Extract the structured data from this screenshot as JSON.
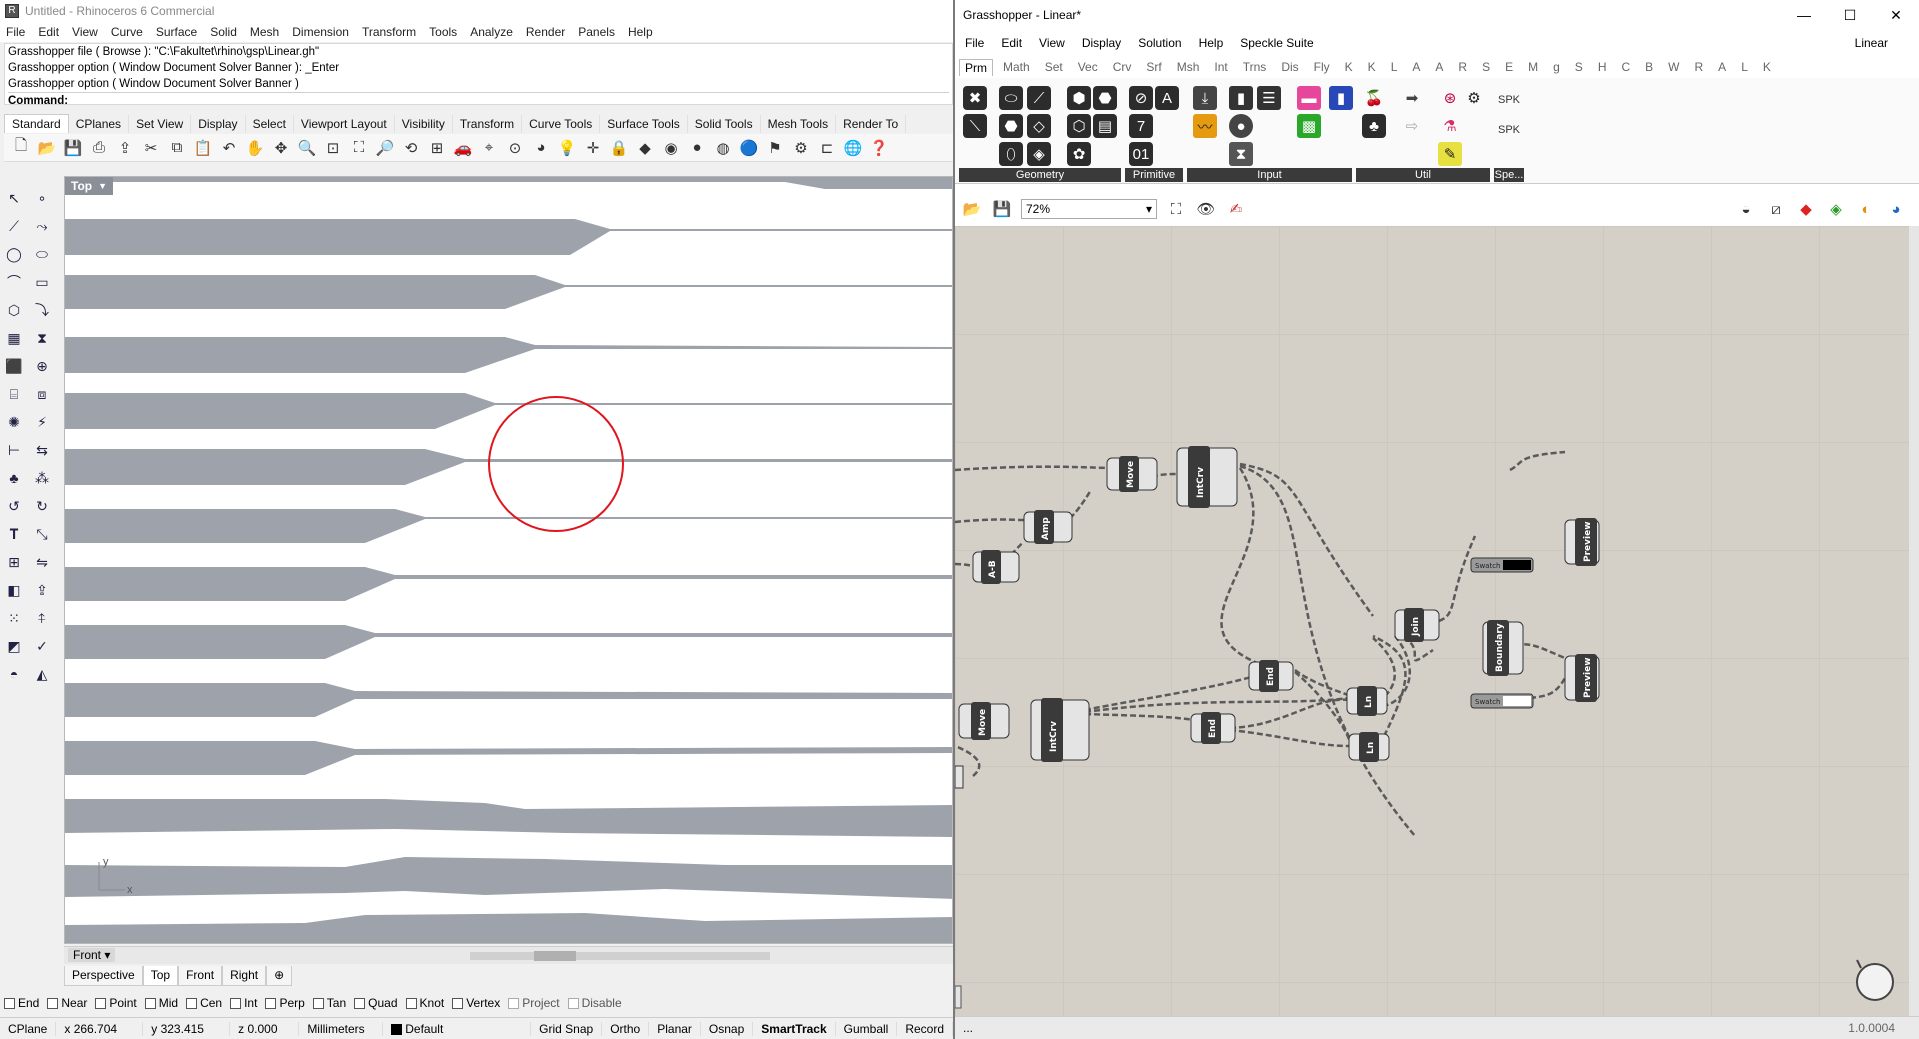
{
  "rhino": {
    "title": "Untitled - Rhinoceros 6 Commercial",
    "menu": [
      "File",
      "Edit",
      "View",
      "Curve",
      "Surface",
      "Solid",
      "Mesh",
      "Dimension",
      "Transform",
      "Tools",
      "Analyze",
      "Render",
      "Panels",
      "Help"
    ],
    "command_history": [
      "Grasshopper file ( Browse ): \"C:\\Fakultet\\rhino\\gsp\\Linear.gh\"",
      "Grasshopper option ( Window  Document  Solver  Banner ): _Enter",
      "Grasshopper option ( Window  Document  Solver  Banner )"
    ],
    "command_prompt": "Command:",
    "toolbar_tabs": [
      "Standard",
      "CPlanes",
      "Set View",
      "Display",
      "Select",
      "Viewport Layout",
      "Visibility",
      "Transform",
      "Curve Tools",
      "Surface Tools",
      "Solid Tools",
      "Mesh Tools",
      "Render To"
    ],
    "viewport_label": "Top",
    "axis_y": "y",
    "axis_x": "x",
    "bottom_view": "Front",
    "view_tabs": [
      "Perspective",
      "Top",
      "Front",
      "Right"
    ],
    "view_tab_add": "⊕",
    "osnaps": [
      "End",
      "Near",
      "Point",
      "Mid",
      "Cen",
      "Int",
      "Perp",
      "Tan",
      "Quad",
      "Knot",
      "Vertex",
      "Project",
      "Disable"
    ],
    "status": {
      "cplane": "CPlane",
      "x": "x 266.704",
      "y": "y 323.415",
      "z": "z 0.000",
      "units": "Millimeters",
      "layer": "Default",
      "grid_snap": "Grid Snap",
      "ortho": "Ortho",
      "planar": "Planar",
      "osnap": "Osnap",
      "smarttrack": "SmartTrack",
      "gumball": "Gumball",
      "record": "Record"
    },
    "colors": {
      "strip": "#9ea3ab",
      "circle": "#e0161e"
    }
  },
  "grasshopper": {
    "title": "Grasshopper - Linear*",
    "menu": [
      "File",
      "Edit",
      "View",
      "Display",
      "Solution",
      "Help",
      "Speckle Suite"
    ],
    "document_name": "Linear",
    "ribbon_tabs": [
      "Prm",
      "Math",
      "Set",
      "Vec",
      "Crv",
      "Srf",
      "Msh",
      "Int",
      "Trns",
      "Dis",
      "Fly",
      "K",
      "K",
      "L",
      "A",
      "A",
      "R",
      "S",
      "E",
      "M",
      "g",
      "S",
      "H",
      "C",
      "B",
      "W",
      "R",
      "A",
      "L",
      "K"
    ],
    "panel_groups": [
      "Geometry",
      "Primitive",
      "Input",
      "Util",
      "Spe..."
    ],
    "zoom": "72%",
    "status_left": "...",
    "version": "1.0.0004",
    "nodes": {
      "move_top": "Move",
      "intcrv_top": "IntCrv",
      "amp": "Amp",
      "ab": "A-B",
      "join": "Join",
      "end_mid": "End",
      "boundary": "Boundary",
      "move_bottom": "Move",
      "intcrv_bottom": "IntCrv",
      "end_bottom": "End",
      "ln_top": "Ln",
      "ln_bottom": "Ln",
      "preview_top": "Preview",
      "preview_bottom": "Preview",
      "swatch_top": "Swatch",
      "swatch_bottom": "Swatch"
    },
    "colors": {
      "canvas": "#d4d0c8",
      "node": "#3a3a3a",
      "swatch_top": "#000000",
      "swatch_bottom": "#ffffff"
    }
  }
}
